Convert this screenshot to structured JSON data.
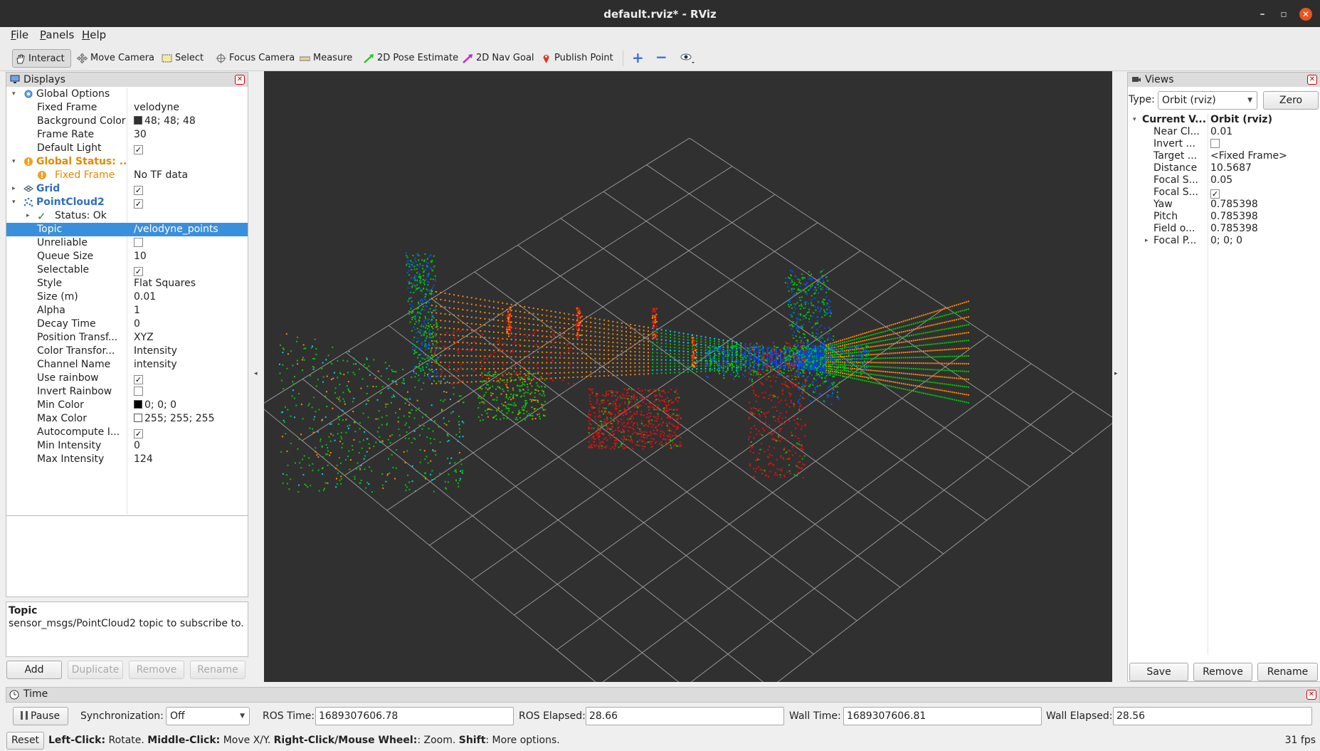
{
  "window": {
    "title": "default.rviz* - RViz"
  },
  "menu": [
    {
      "key": "F",
      "rest": "ile"
    },
    {
      "key": "P",
      "rest": "anels"
    },
    {
      "key": "H",
      "rest": "elp"
    }
  ],
  "toolbar": {
    "interact": "Interact",
    "move_camera": "Move Camera",
    "select": "Select",
    "focus_camera": "Focus Camera",
    "measure": "Measure",
    "pose_estimate": "2D Pose Estimate",
    "nav_goal": "2D Nav Goal",
    "publish_point": "Publish Point",
    "icons": [
      "plus-icon",
      "minus-icon",
      "eye-icon"
    ]
  },
  "displays": {
    "title": "Displays",
    "rows": [
      {
        "k": "Global Options",
        "v": ""
      },
      {
        "k": "Fixed Frame",
        "v": "velodyne"
      },
      {
        "k": "Background Color",
        "v": "48; 48; 48",
        "swatch": "#303030"
      },
      {
        "k": "Frame Rate",
        "v": "30"
      },
      {
        "k": "Default Light",
        "v": "",
        "check": true
      },
      {
        "k": "Global Status: ...",
        "v": ""
      },
      {
        "k": "Fixed Frame",
        "v": "No TF data"
      },
      {
        "k": "Grid",
        "v": "",
        "check": true
      },
      {
        "k": "PointCloud2",
        "v": "",
        "check": true
      },
      {
        "k": "Status: Ok",
        "v": ""
      },
      {
        "k": "Topic",
        "v": "/velodyne_points"
      },
      {
        "k": "Unreliable",
        "v": "",
        "check": false
      },
      {
        "k": "Queue Size",
        "v": "10"
      },
      {
        "k": "Selectable",
        "v": "",
        "check": true
      },
      {
        "k": "Style",
        "v": "Flat Squares"
      },
      {
        "k": "Size (m)",
        "v": "0.01"
      },
      {
        "k": "Alpha",
        "v": "1"
      },
      {
        "k": "Decay Time",
        "v": "0"
      },
      {
        "k": "Position Transf...",
        "v": "XYZ"
      },
      {
        "k": "Color Transfor...",
        "v": "Intensity"
      },
      {
        "k": "Channel Name",
        "v": "intensity"
      },
      {
        "k": "Use rainbow",
        "v": "",
        "check": true
      },
      {
        "k": "Invert Rainbow",
        "v": "",
        "check": false
      },
      {
        "k": "Min Color",
        "v": "0; 0; 0",
        "swatch": "#000000"
      },
      {
        "k": "Max Color",
        "v": "255; 255; 255",
        "swatch": "#ffffff"
      },
      {
        "k": "Autocompute I...",
        "v": "",
        "check": true
      },
      {
        "k": "Min Intensity",
        "v": "0"
      },
      {
        "k": "Max Intensity",
        "v": "124"
      }
    ],
    "desc_title": "Topic",
    "desc_text": "sensor_msgs/PointCloud2 topic to subscribe to.",
    "buttons": {
      "add": "Add",
      "duplicate": "Duplicate",
      "remove": "Remove",
      "rename": "Rename"
    }
  },
  "views": {
    "title": "Views",
    "type_label": "Type:",
    "type_value": "Orbit (rviz)",
    "zero": "Zero",
    "rows": [
      {
        "k": "Current V...",
        "v": "Orbit (rviz)"
      },
      {
        "k": "Near Cl...",
        "v": "0.01"
      },
      {
        "k": "Invert ...",
        "v": "",
        "check": false
      },
      {
        "k": "Target ...",
        "v": "<Fixed Frame>"
      },
      {
        "k": "Distance",
        "v": "10.5687"
      },
      {
        "k": "Focal S...",
        "v": "0.05"
      },
      {
        "k": "Focal S...",
        "v": "",
        "check": true
      },
      {
        "k": "Yaw",
        "v": "0.785398"
      },
      {
        "k": "Pitch",
        "v": "0.785398"
      },
      {
        "k": "Field o...",
        "v": "0.785398"
      },
      {
        "k": "Focal P...",
        "v": "0; 0; 0"
      }
    ],
    "buttons": {
      "save": "Save",
      "remove": "Remove",
      "rename": "Rename"
    }
  },
  "time": {
    "title": "Time",
    "pause": "Pause",
    "sync_label": "Synchronization:",
    "sync_value": "Off",
    "ros_time_label": "ROS Time:",
    "ros_time": "1689307606.78",
    "ros_elapsed_label": "ROS Elapsed:",
    "ros_elapsed": "28.66",
    "wall_time_label": "Wall Time:",
    "wall_time": "1689307606.81",
    "wall_elapsed_label": "Wall Elapsed:",
    "wall_elapsed": "28.56"
  },
  "status": {
    "reset": "Reset",
    "b1": "Left-Click:",
    "t1": " Rotate. ",
    "b2": "Middle-Click:",
    "t2": " Move X/Y. ",
    "b3": "Right-Click/Mouse Wheel:",
    "t3": ": Zoom. ",
    "b4": "Shift",
    "t4": ": More options.",
    "fps": "31 fps"
  },
  "colors": {
    "accent": "#3a8fdc",
    "warning": "#e08a00",
    "selection": "#3a8fdc",
    "point_cloud": [
      "#00c800",
      "#0050ff",
      "#e01010",
      "#ff8800",
      "#00d0ff"
    ]
  }
}
